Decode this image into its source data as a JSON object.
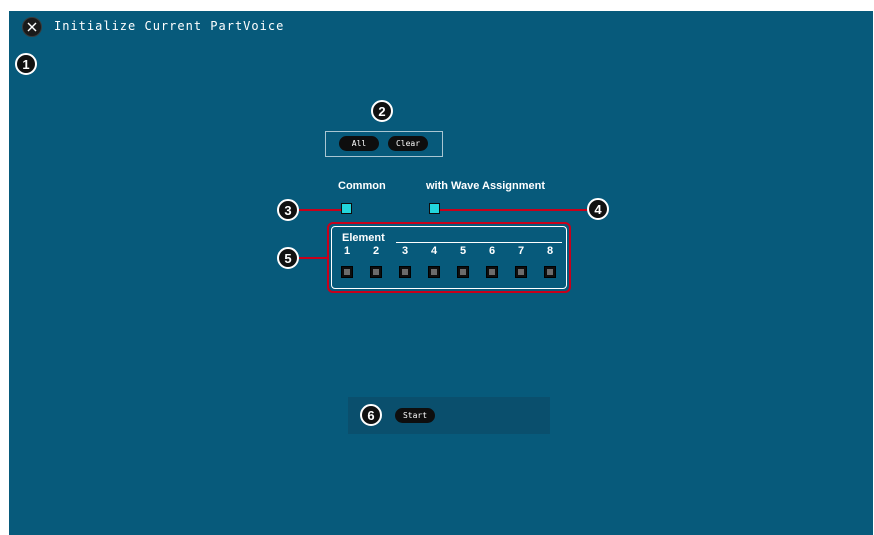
{
  "header": {
    "title": "Initialize Current PartVoice",
    "close_icon": "close-icon"
  },
  "callouts": [
    "1",
    "2",
    "3",
    "4",
    "5",
    "6"
  ],
  "select_buttons": {
    "all_label": "All",
    "clear_label": "Clear"
  },
  "options": {
    "common_label": "Common",
    "wave_label": "with Wave Assignment"
  },
  "element": {
    "title": "Element",
    "numbers": [
      "1",
      "2",
      "3",
      "4",
      "5",
      "6",
      "7",
      "8"
    ]
  },
  "start": {
    "label": "Start"
  },
  "colors": {
    "background": "#075a7b",
    "checkbox_on": "#22d5dc",
    "callout_line": "#c8001a"
  }
}
